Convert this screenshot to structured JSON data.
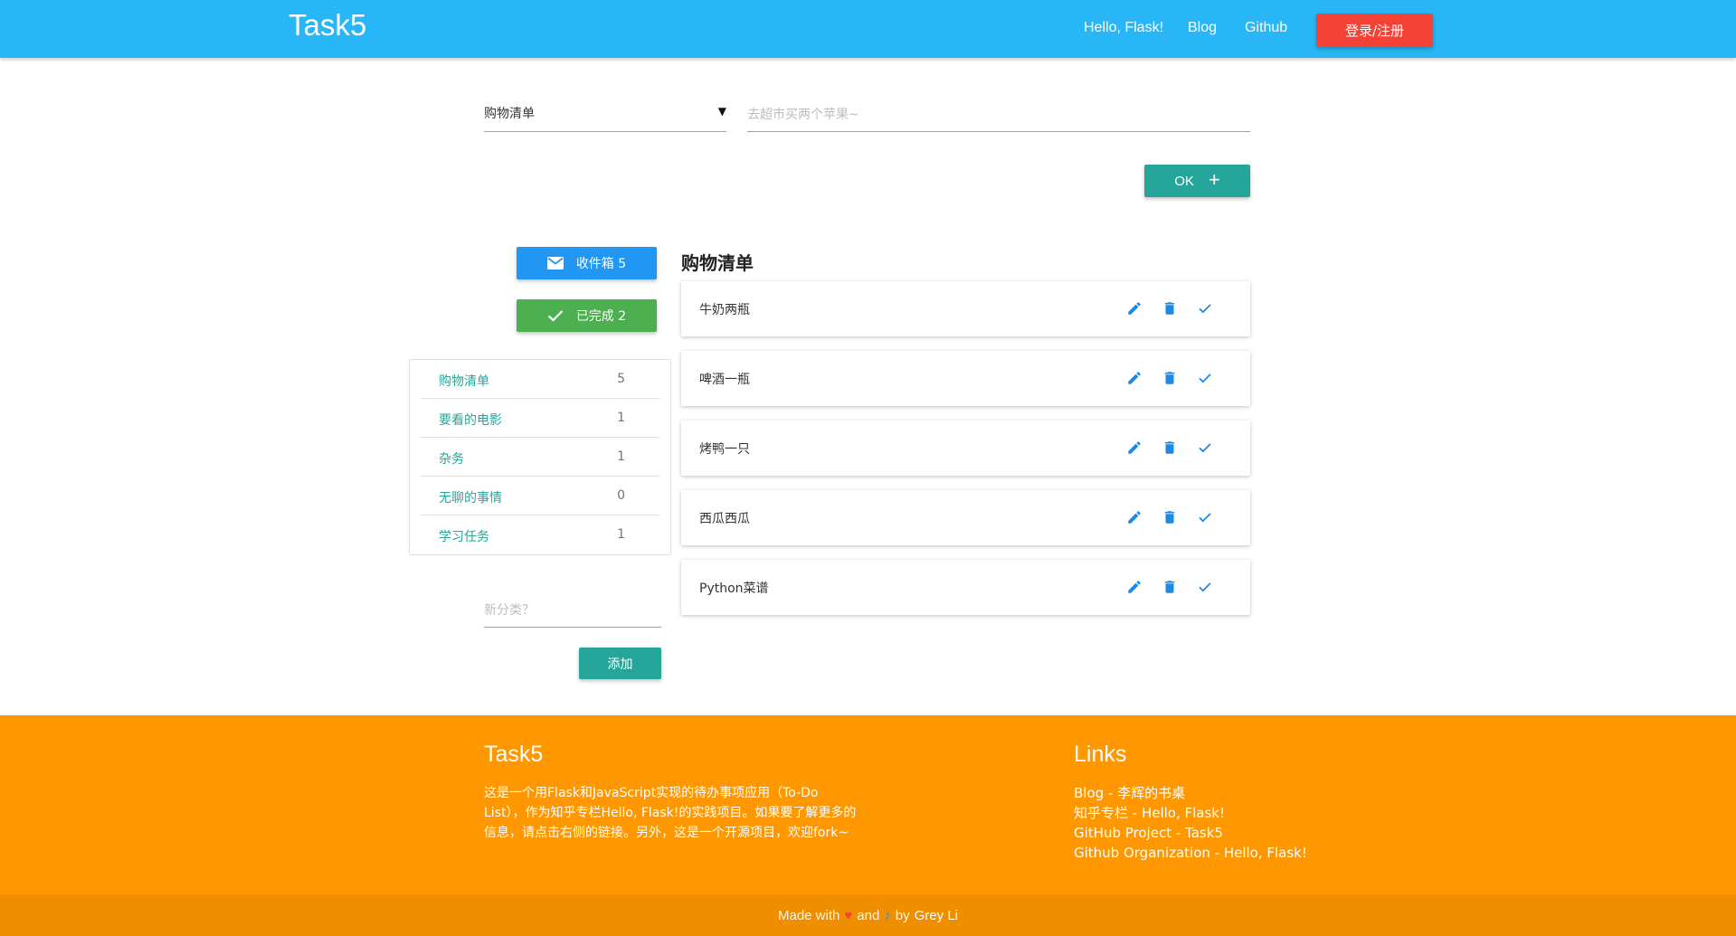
{
  "navbar": {
    "brand": "Task5",
    "links": [
      "Hello, Flask!",
      "Blog",
      "Github"
    ],
    "login_label": "登录/注册"
  },
  "form": {
    "category_selected": "购物清单",
    "item_placeholder": "去超市买两个苹果~",
    "ok_label": "OK"
  },
  "sidebar": {
    "inbox_label": "收件箱 5",
    "done_label": "已完成 2",
    "categories": [
      {
        "name": "购物清单",
        "count": "5"
      },
      {
        "name": "要看的电影",
        "count": "1"
      },
      {
        "name": "杂务",
        "count": "1"
      },
      {
        "name": "无聊的事情",
        "count": "0"
      },
      {
        "name": "学习任务",
        "count": "1"
      }
    ],
    "new_category_placeholder": "新分类？",
    "add_label": "添加"
  },
  "main": {
    "list_title": "购物清单",
    "items": [
      {
        "text": "牛奶两瓶"
      },
      {
        "text": "啤酒一瓶"
      },
      {
        "text": "烤鸭一只"
      },
      {
        "text": "西瓜西瓜"
      },
      {
        "text": "Python菜谱"
      }
    ]
  },
  "footer": {
    "title": "Task5",
    "description": "这是一个用Flask和JavaScript实现的待办事项应用（To-Do List），作为知乎专栏Hello, Flask!的实践项目。如果要了解更多的信息，请点击右侧的链接。另外，这是一个开源项目，欢迎fork~",
    "links_title": "Links",
    "links": [
      "Blog - 李辉的书桌",
      "知乎专栏 - Hello, Flask!",
      "GitHub Project - Task5",
      "Github Organization - Hello, Flask!"
    ],
    "copyright_made": "Made with",
    "copyright_and": "and",
    "copyright_by": "by",
    "copyright_author": "Grey Li"
  },
  "colors": {
    "navbar": "#29b6f6",
    "login": "#f44336",
    "teal": "#26a69a",
    "inbox": "#2196f3",
    "done": "#4caf50",
    "footer": "#ff9800",
    "footer_bar": "#ef8f00",
    "action_icon": "#1e88e5"
  },
  "icons": {
    "inbox": "mail-icon",
    "done": "check-icon",
    "item_edit": "pencil-icon",
    "item_delete": "trash-icon",
    "item_done": "check-icon"
  }
}
